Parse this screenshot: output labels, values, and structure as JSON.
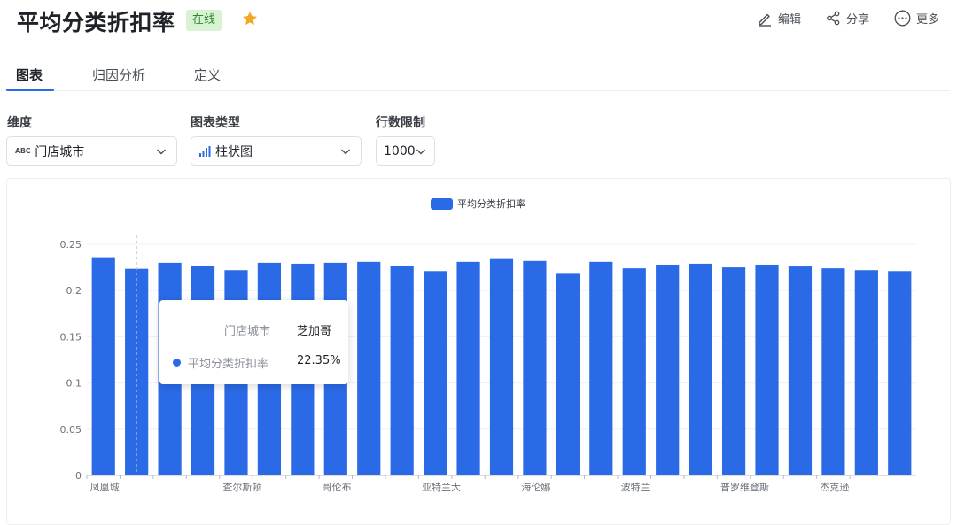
{
  "header": {
    "title": "平均分类折扣率",
    "status": "在线",
    "actions": {
      "edit": "编辑",
      "share": "分享",
      "more": "更多"
    }
  },
  "tabs": [
    {
      "label": "图表",
      "active": true
    },
    {
      "label": "归因分析",
      "active": false
    },
    {
      "label": "定义",
      "active": false
    }
  ],
  "controls": {
    "dimension": {
      "label": "维度",
      "type_badge": "ABC",
      "value": "门店城市"
    },
    "chart_type": {
      "label": "图表类型",
      "value": "柱状图"
    },
    "row_limit": {
      "label": "行数限制",
      "value": "1000"
    }
  },
  "tooltip": {
    "dimension_name": "门店城市",
    "dimension_value": "芝加哥",
    "series_name": "平均分类折扣率",
    "series_value": "22.35%"
  },
  "colors": {
    "accent": "#2b6ae6",
    "star": "#f5a623",
    "status_bg": "#d9f2d4",
    "status_text": "#2a8a2a"
  },
  "icons": {
    "star": "star-icon",
    "edit": "pen-icon",
    "share": "share-icon",
    "more": "ellipsis-circle-icon",
    "bar_chart": "bar-chart-icon",
    "chevron": "chevron-down-icon"
  },
  "chart_data": {
    "type": "bar",
    "legend": "平均分类折扣率",
    "legend_position": "top-center",
    "grid": true,
    "ylim": [
      0,
      0.25
    ],
    "yticks": [
      "0",
      "0.05",
      "0.1",
      "0.15",
      "0.2",
      "0.25"
    ],
    "categories": [
      "凤凰城",
      "芝加哥",
      "",
      "",
      "查尔斯顿",
      "",
      "",
      "哥伦布",
      "",
      "",
      "亚特兰大",
      "",
      "",
      "海伦娜",
      "",
      "",
      "波特兰",
      "",
      "",
      "普罗维登斯",
      "",
      "",
      "杰克逊",
      "",
      ""
    ],
    "values": [
      0.236,
      0.2235,
      0.23,
      0.227,
      0.222,
      0.23,
      0.229,
      0.23,
      0.231,
      0.227,
      0.221,
      0.231,
      0.235,
      0.232,
      0.219,
      0.231,
      0.224,
      0.228,
      0.229,
      0.225,
      0.228,
      0.226,
      0.224,
      0.222,
      0.221
    ],
    "highlight_index": 1
  }
}
